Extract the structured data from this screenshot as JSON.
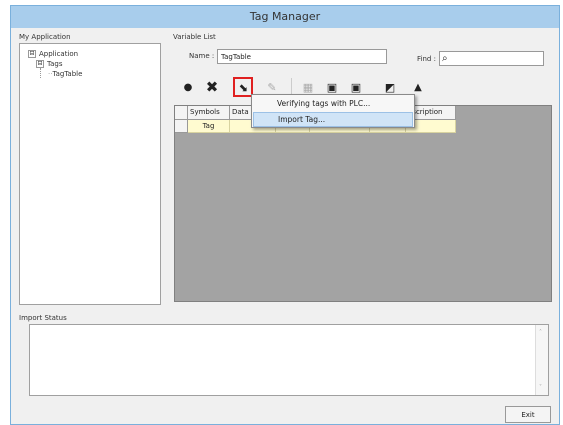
{
  "window": {
    "title": "Tag Manager"
  },
  "app_panel": {
    "label": "My Application",
    "tree": [
      {
        "label": "Application",
        "toggle": "⊟"
      },
      {
        "label": "Tags",
        "toggle": "⊟"
      },
      {
        "label": "TagTable"
      }
    ]
  },
  "variable_list": {
    "label": "Variable List",
    "name_label": "Name :",
    "name_value": "TagTable",
    "find_label": "Find :",
    "find_value": ""
  },
  "toolbar": {
    "add_icon": "●",
    "delete_icon": "✖",
    "tag_tool_icon": "⬊",
    "edit_icon": "✎",
    "grid_icon": "▦",
    "btn_a_icon": "▣",
    "btn_b_icon": "▣",
    "btn_c_icon": "◩",
    "btn_d_icon": "▲"
  },
  "table": {
    "headers": [
      "Symbols",
      "Data",
      "",
      "",
      "",
      "escription"
    ],
    "rows": [
      [
        "Tag",
        "",
        "",
        "",
        "",
        ""
      ]
    ]
  },
  "context_menu": {
    "items": [
      "Verifying tags with PLC...",
      "Import Tag..."
    ]
  },
  "import_status": {
    "label": "Import Status"
  },
  "buttons": {
    "exit": "Exit"
  },
  "colors": {
    "titlebar": "#a8cdec",
    "highlight": "#d0e4f7",
    "selected_border": "#e02020",
    "row_fill": "#fffbd0"
  }
}
